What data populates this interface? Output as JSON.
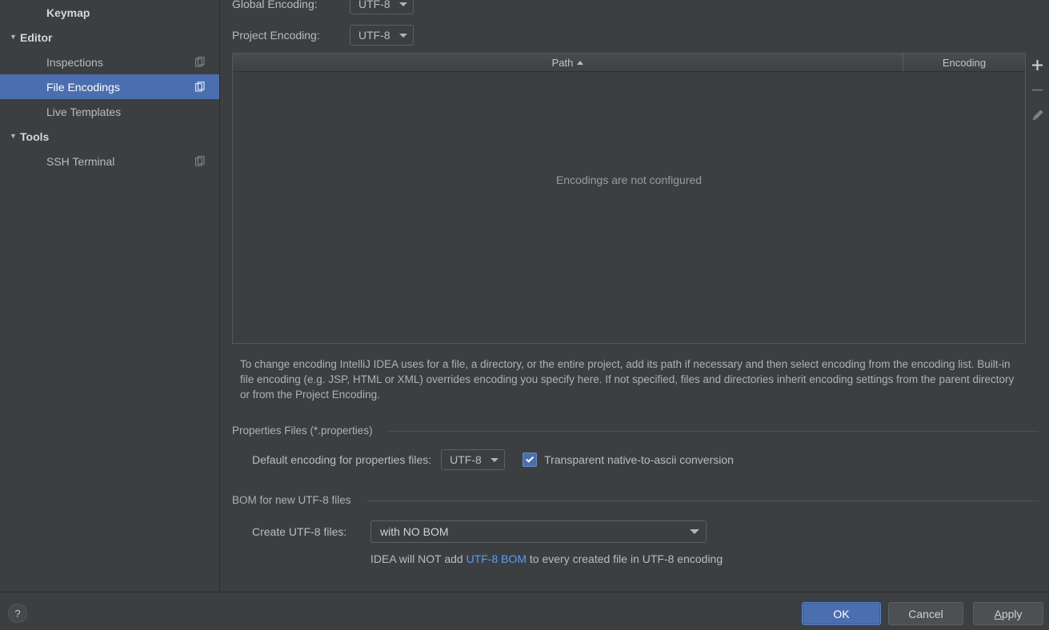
{
  "sidebar": {
    "items": [
      {
        "label": "Keymap",
        "type": "root",
        "arrow": "",
        "selected": false,
        "copy_icon": false
      },
      {
        "label": "Editor",
        "type": "group",
        "arrow": "▼",
        "selected": false,
        "copy_icon": false
      },
      {
        "label": "Inspections",
        "type": "indent",
        "arrow": "",
        "selected": false,
        "copy_icon": true
      },
      {
        "label": "File Encodings",
        "type": "indent",
        "arrow": "",
        "selected": true,
        "copy_icon": true
      },
      {
        "label": "Live Templates",
        "type": "indent",
        "arrow": "",
        "selected": false,
        "copy_icon": false
      },
      {
        "label": "Tools",
        "type": "group",
        "arrow": "▼",
        "selected": false,
        "copy_icon": false
      },
      {
        "label": "SSH Terminal",
        "type": "indent",
        "arrow": "",
        "selected": false,
        "copy_icon": true
      }
    ],
    "copy_icon_name": "copy-settings-icon"
  },
  "main": {
    "global_encoding": {
      "label": "Global Encoding:",
      "value": "UTF-8"
    },
    "project_encoding": {
      "label": "Project Encoding:",
      "value": "UTF-8"
    },
    "table": {
      "columns": [
        "Path",
        "Encoding"
      ],
      "sort_column": "Path",
      "sort_direction": "ascending",
      "rows": [],
      "empty_message": "Encodings are not configured"
    },
    "table_toolbar": [
      {
        "name": "add-encoding-button",
        "glyph": "+",
        "enabled": true
      },
      {
        "name": "remove-encoding-button",
        "glyph": "−",
        "enabled": false
      },
      {
        "name": "edit-encoding-button",
        "glyph": "✎",
        "enabled": false
      }
    ],
    "description": "To change encoding IntelliJ IDEA uses for a file, a directory, or the entire project, add its path if necessary and then select encoding from the encoding list. Built-in file encoding (e.g. JSP, HTML or XML) overrides encoding you specify here. If not specified, files and directories inherit encoding settings from the parent directory or from the Project Encoding.",
    "properties_section": {
      "title": "Properties Files (*.properties)",
      "default_encoding_label": "Default encoding for properties files:",
      "default_encoding_value": "UTF-8",
      "transparent_checkbox_label": "Transparent native-to-ascii conversion",
      "transparent_checked": true
    },
    "bom_section": {
      "title": "BOM for new UTF-8 files",
      "create_label": "Create UTF-8 files:",
      "create_value": "with NO BOM",
      "hint_prefix": "IDEA will NOT add ",
      "hint_link": "UTF-8 BOM",
      "hint_suffix": " to every created file in UTF-8 encoding"
    }
  },
  "footer": {
    "help_glyph": "?",
    "ok_label": "OK",
    "cancel_label": "Cancel",
    "apply_mnemonic": "A",
    "apply_rest": "pply"
  },
  "colors": {
    "window_bg": "#3c3f41",
    "selection_blue": "#4b6eaf",
    "link_blue": "#589df6",
    "text": "#bbbbbb",
    "border": "#5e6060"
  }
}
